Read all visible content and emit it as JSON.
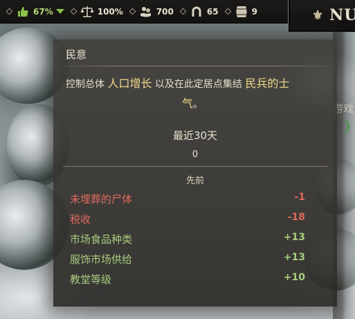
{
  "resources": [
    {
      "icon": "thumbs-up-icon",
      "value": "67%",
      "trend": "down"
    },
    {
      "icon": "scales-icon",
      "value": "100%"
    },
    {
      "icon": "hand-coins-icon",
      "value": "700"
    },
    {
      "icon": "horseshoe-icon",
      "value": "65"
    },
    {
      "icon": "barrel-icon",
      "value": "9"
    }
  ],
  "title": {
    "icon": "fleur-de-lis-icon",
    "text": "NUS"
  },
  "background": {
    "partial_text": "游戏"
  },
  "tooltip": {
    "title": "民意",
    "description": {
      "part1": "控制总体",
      "highlight1": "人口增长",
      "part2": "以及在此定居点集结",
      "highlight2": "民兵",
      "part3": "的",
      "highlight3": "士",
      "wrap": "气",
      "end": "。"
    },
    "period_label": "最近30天",
    "period_value": "0",
    "previous_label": "先前",
    "factors": [
      {
        "label": "未埋葬的尸体",
        "value": "-1",
        "sign": "negative"
      },
      {
        "label": "税收",
        "value": "-18",
        "sign": "negative"
      },
      {
        "label": "市场食品种类",
        "value": "+13",
        "sign": "positive"
      },
      {
        "label": "服饰市场供给",
        "value": "+13",
        "sign": "positive"
      },
      {
        "label": "教堂等级",
        "value": "+10",
        "sign": "positive"
      }
    ]
  },
  "colors": {
    "highlight": "#f0d88a",
    "negative": "#e06a5c",
    "positive": "#a9cd7e",
    "trend_down": "#8bc34a"
  }
}
